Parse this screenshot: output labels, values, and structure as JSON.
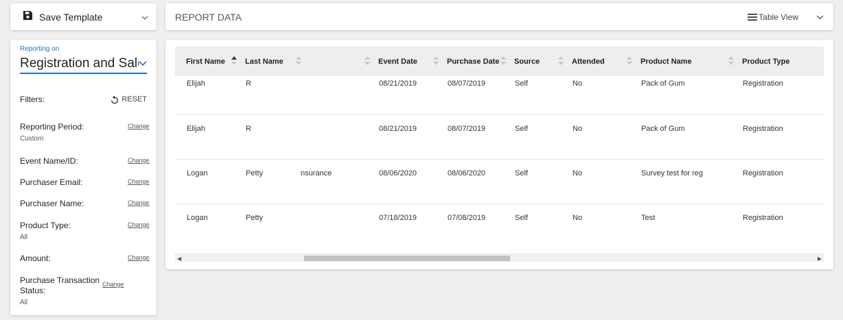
{
  "save_template": {
    "label": "Save Template",
    "icon": "floppy-disk-icon"
  },
  "report_header": {
    "title": "REPORT DATA",
    "view_label": "Table View"
  },
  "reporting": {
    "label": "Reporting on",
    "value": "Registration and Sales I..."
  },
  "filters": {
    "title": "Filters:",
    "reset_label": "RESET",
    "items": [
      {
        "name": "Reporting Period:",
        "value": "Custom",
        "change": "Change"
      },
      {
        "name": "Event Name/ID:",
        "value": "",
        "change": "Change"
      },
      {
        "name": "Purchaser Email:",
        "value": "",
        "change": "Change"
      },
      {
        "name": "Purchaser Name:",
        "value": "",
        "change": "Change"
      },
      {
        "name": "Product Type:",
        "value": "All",
        "change": "Change"
      },
      {
        "name": "Amount:",
        "value": "",
        "change": "Change"
      },
      {
        "name": "Purchase Transaction Status:",
        "value": "All",
        "change": "Change"
      }
    ]
  },
  "table": {
    "columns": [
      "First Name",
      "Last Name",
      "",
      "Event Date",
      "Purchase Date",
      "Source",
      "Attended",
      "Product Name",
      "Product Type"
    ],
    "sorted_column": 0,
    "rows": [
      [
        "Elijah",
        "R",
        "",
        "08/21/2019",
        "08/07/2019",
        "Self",
        "No",
        "Pack of Gum",
        "Registration"
      ],
      [
        "Elijah",
        "R",
        "",
        "08/21/2019",
        "08/07/2019",
        "Self",
        "No",
        "Pack of Gum",
        "Registration"
      ],
      [
        "Logan",
        "Petty",
        "nsurance",
        "08/06/2020",
        "08/06/2020",
        "Self",
        "No",
        "Survey test for reg",
        "Registration"
      ],
      [
        "Logan",
        "Petty",
        "",
        "07/18/2019",
        "07/08/2019",
        "Self",
        "No",
        "Test",
        "Registration"
      ]
    ]
  },
  "colors": {
    "accent": "#1a73c8",
    "header_bg": "#eeeeee",
    "page_bg": "#efefef"
  }
}
